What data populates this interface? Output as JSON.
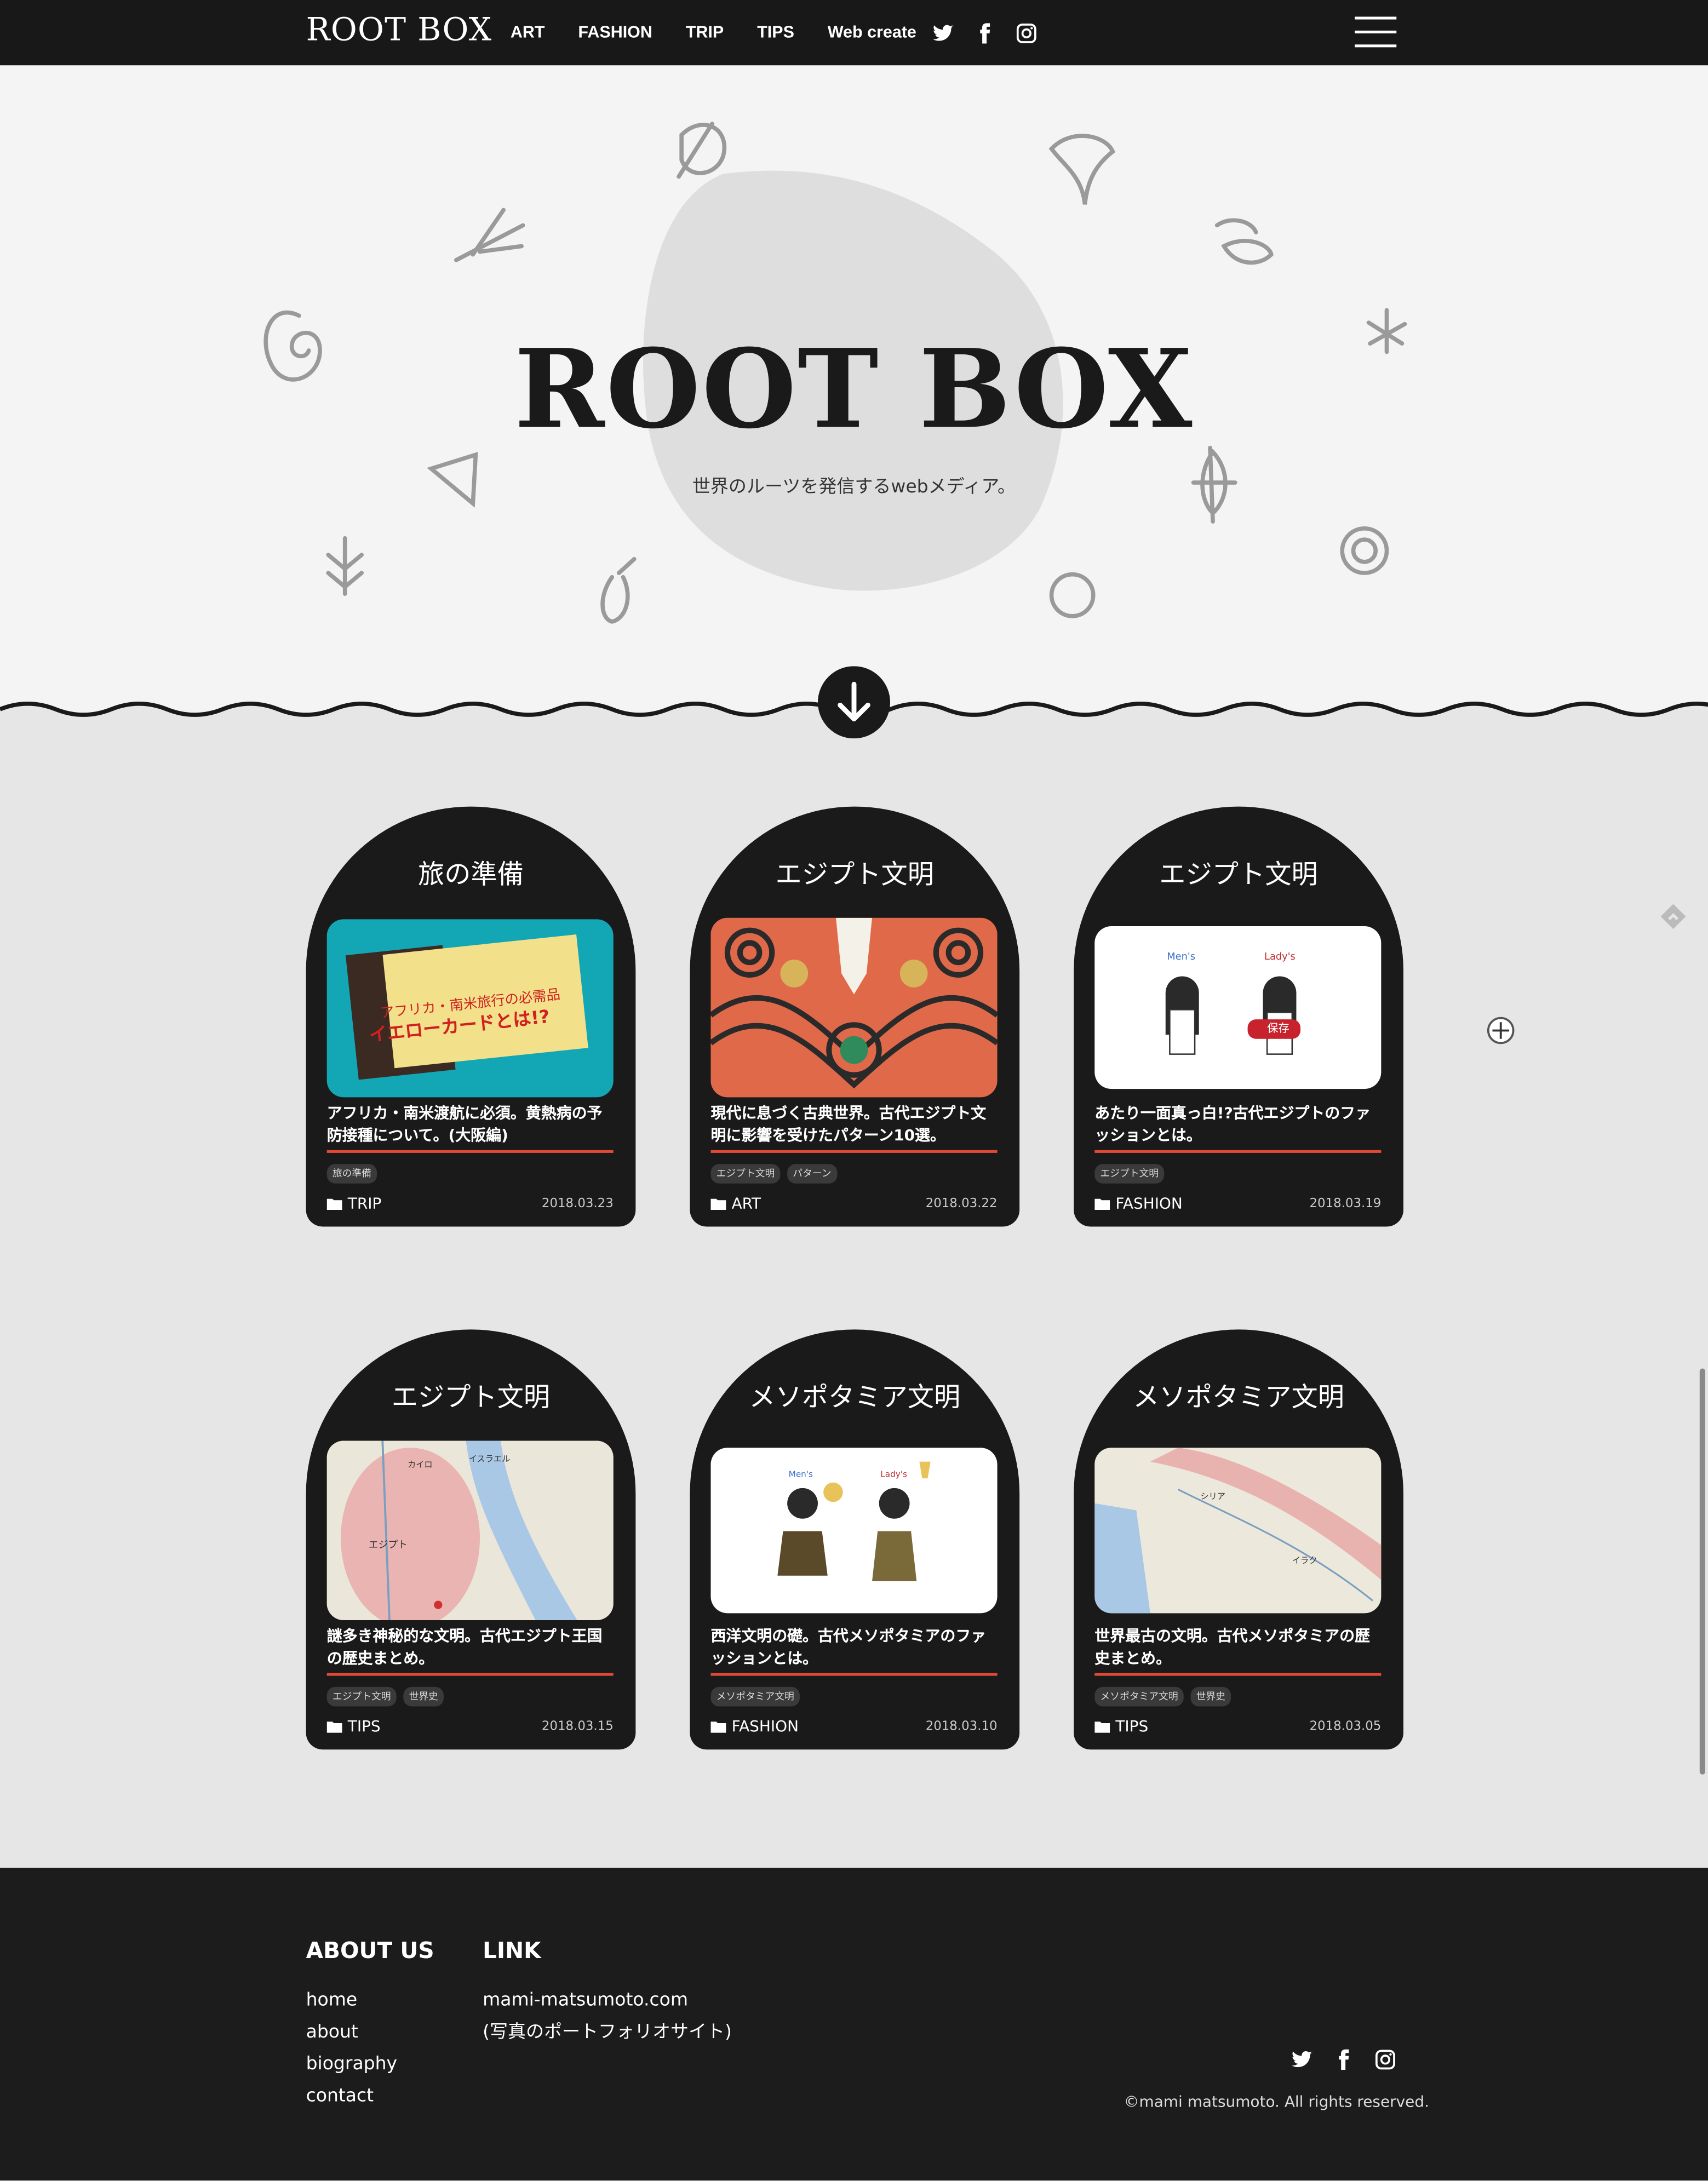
{
  "header": {
    "logo": "ROOT BOX",
    "nav": [
      "ART",
      "FASHION",
      "TRIP",
      "TIPS",
      "Web create"
    ]
  },
  "hero": {
    "title": "ROOT BOX",
    "subtitle": "世界のルーツを発信するwebメディア。"
  },
  "cards": [
    {
      "category_title": "旅の準備",
      "title": "アフリカ・南米渡航に必須。黄熱病の予防接種について。(大阪編)",
      "tags": [
        "旅の準備"
      ],
      "category": "TRIP",
      "date": "2018.03.23",
      "image_text": [
        "アフリカ・南米旅行の必需品",
        "イエローカードとは!?"
      ]
    },
    {
      "category_title": "エジプト文明",
      "title": "現代に息づく古典世界。古代エジプト文明に影響を受けたパターン10選。",
      "tags": [
        "エジプト文明",
        "パターン"
      ],
      "category": "ART",
      "date": "2018.03.22"
    },
    {
      "category_title": "エジプト文明",
      "title": "あたり一面真っ白!?古代エジプトのファッションとは。",
      "tags": [
        "エジプト文明"
      ],
      "category": "FASHION",
      "date": "2018.03.19",
      "image_text": [
        "Men's",
        "Lady's",
        "保存"
      ]
    },
    {
      "category_title": "エジプト文明",
      "title": "謎多き神秘的な文明。古代エジプト王国の歴史まとめ。",
      "tags": [
        "エジプト文明",
        "世界史"
      ],
      "category": "TIPS",
      "date": "2018.03.15",
      "image_text": [
        "エジプト",
        "イスラエル",
        "カイロ"
      ]
    },
    {
      "category_title": "メソポタミア文明",
      "title": "西洋文明の礎。古代メソポタミアのファッションとは。",
      "tags": [
        "メソポタミア文明"
      ],
      "category": "FASHION",
      "date": "2018.03.10",
      "image_text": [
        "Men's",
        "Lady's"
      ]
    },
    {
      "category_title": "メソポタミア文明",
      "title": "世界最古の文明。古代メソポタミアの歴史まとめ。",
      "tags": [
        "メソポタミア文明",
        "世界史"
      ],
      "category": "TIPS",
      "date": "2018.03.05",
      "image_text": [
        "シリア",
        "イラク"
      ]
    }
  ],
  "footer": {
    "about_heading": "ABOUT US",
    "about_links": [
      "home",
      "about",
      "biography",
      "contact"
    ],
    "link_heading": "LINK",
    "link_url": "mami-matsumoto.com",
    "link_desc": "(写真のポートフォリオサイト)",
    "copyright": "©mami matsumoto. All rights reserved."
  },
  "colors": {
    "dark": "#1a1a1a",
    "accent": "#e04a35",
    "hero_bg": "#f4f4f4",
    "body_bg": "#e6e6e6"
  }
}
